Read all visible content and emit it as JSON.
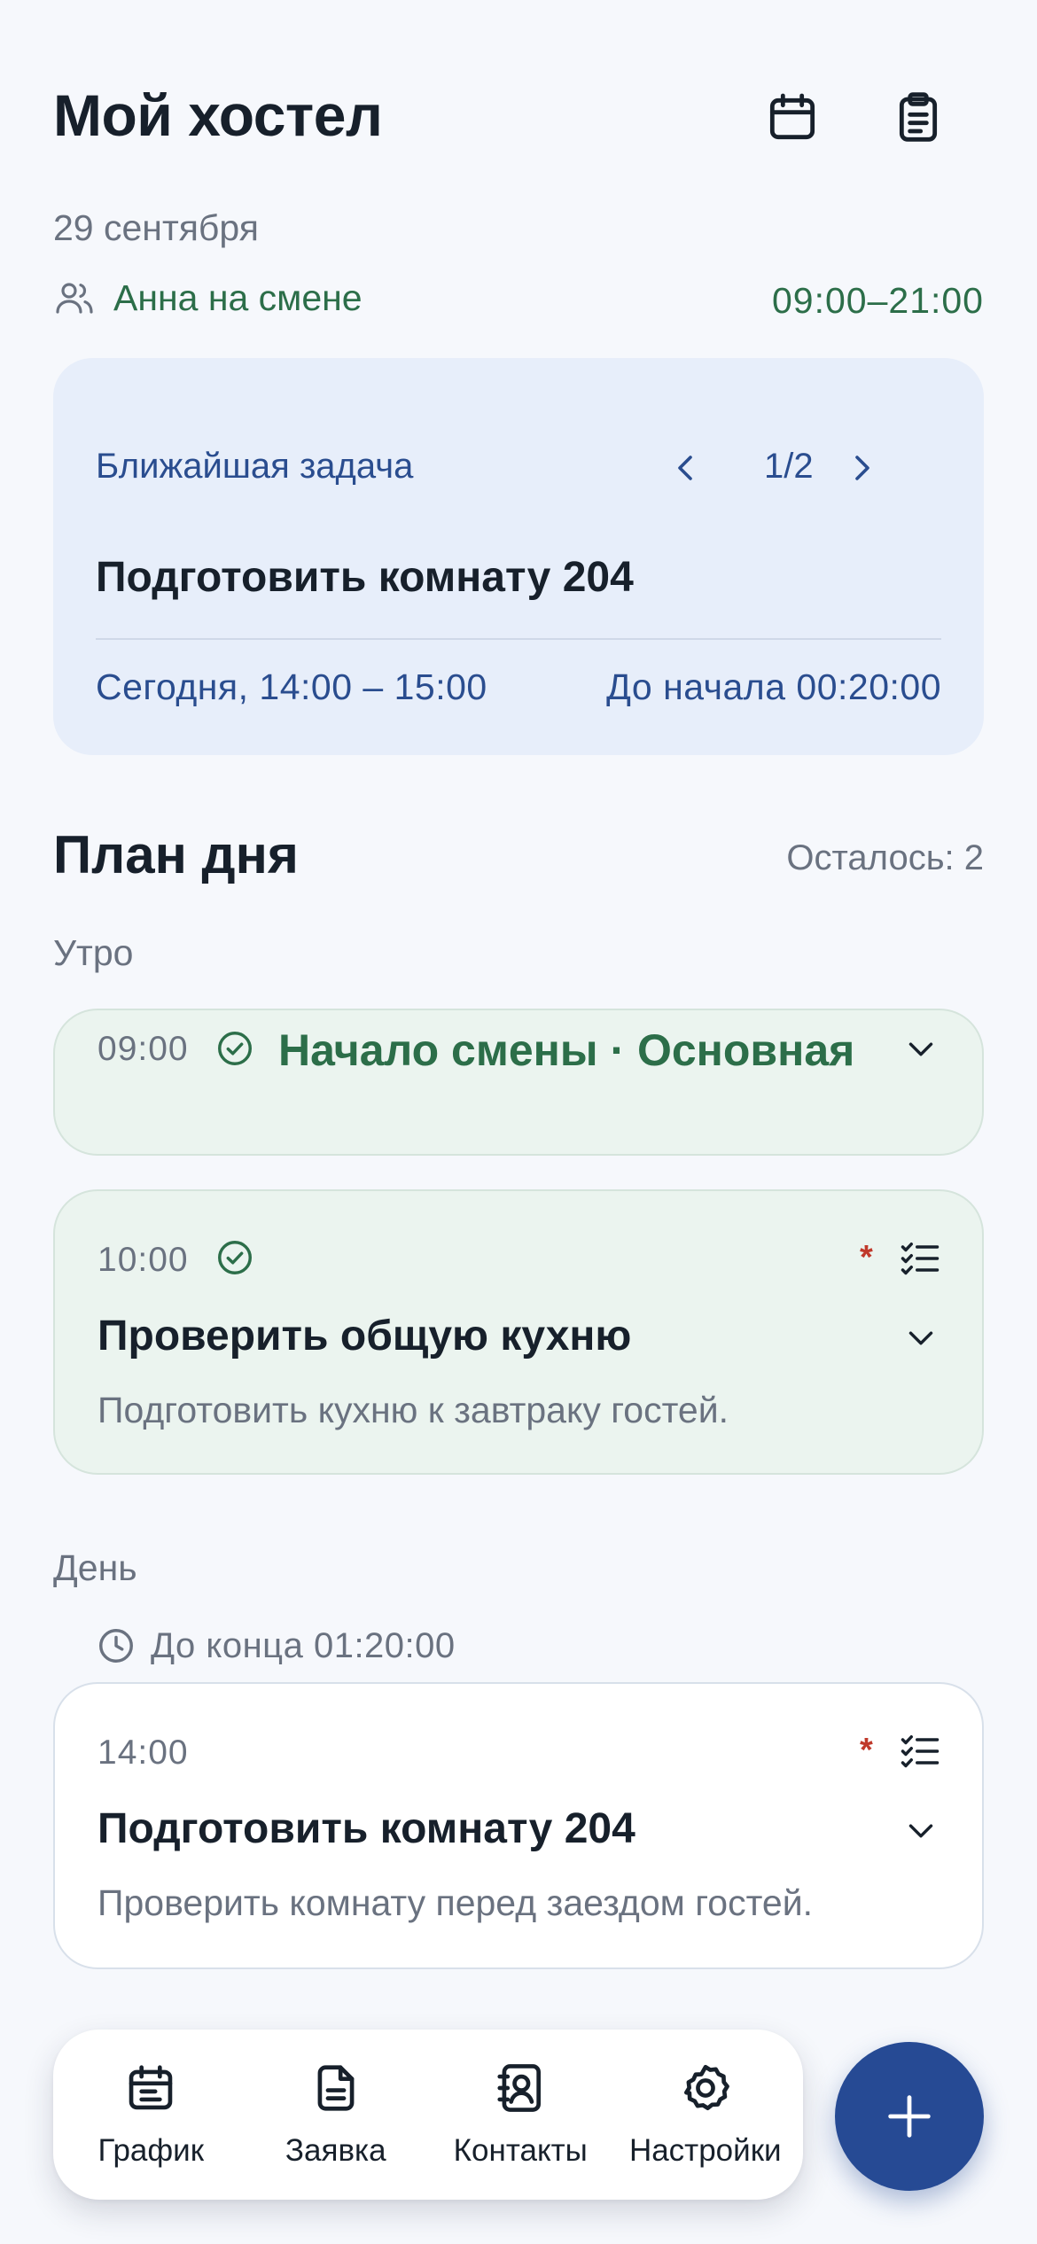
{
  "header": {
    "title": "Мой хостел",
    "date": "29 сентября",
    "shift_person": "Анна на смене",
    "shift_hours": "09:00–21:00"
  },
  "icons": {
    "calendar": "calendar-icon",
    "clipboard": "clipboard-icon",
    "users": "users-icon",
    "chevron_left": "chevron-left-icon",
    "chevron_right": "chevron-right-icon",
    "chevron_down": "chevron-down-icon",
    "check_circle": "check-circle-icon",
    "checklist": "checklist-icon",
    "clock": "clock-icon",
    "plus": "plus-icon"
  },
  "nearest_task": {
    "label": "Ближайшая задача",
    "pager": "1/2",
    "title": "Подготовить комнату 204",
    "time": "Сегодня, 14:00 – 15:00",
    "countdown": "До начала 00:20:00"
  },
  "plan": {
    "title": "План дня",
    "remaining": "Осталось: 2",
    "sections": [
      {
        "label": "Утро",
        "tasks": [
          {
            "time": "09:00",
            "title": "Начало смены · Основная",
            "status": "done"
          },
          {
            "time": "10:00",
            "title": "Проверить общую кухню",
            "description": "Подготовить кухню к завтраку гостей.",
            "status": "done",
            "required": "*"
          }
        ]
      },
      {
        "label": "День",
        "countdown": "До конца 01:20:00",
        "tasks": [
          {
            "time": "14:00",
            "title": "Подготовить комнату 204",
            "description": "Проверить комнату перед заездом гостей.",
            "status": "active",
            "required": "*"
          }
        ]
      }
    ]
  },
  "nav": {
    "items": [
      {
        "label": "График",
        "icon": "schedule-icon"
      },
      {
        "label": "Заявка",
        "icon": "document-icon"
      },
      {
        "label": "Контакты",
        "icon": "contacts-icon"
      },
      {
        "label": "Настройки",
        "icon": "settings-icon"
      }
    ]
  },
  "colors": {
    "background": "#f6f8fc",
    "accent_blue": "#264a94",
    "accent_green": "#2c6e49",
    "card_blue": "#e7eefa",
    "card_green": "#ebf4ef",
    "required_red": "#c0392b"
  }
}
